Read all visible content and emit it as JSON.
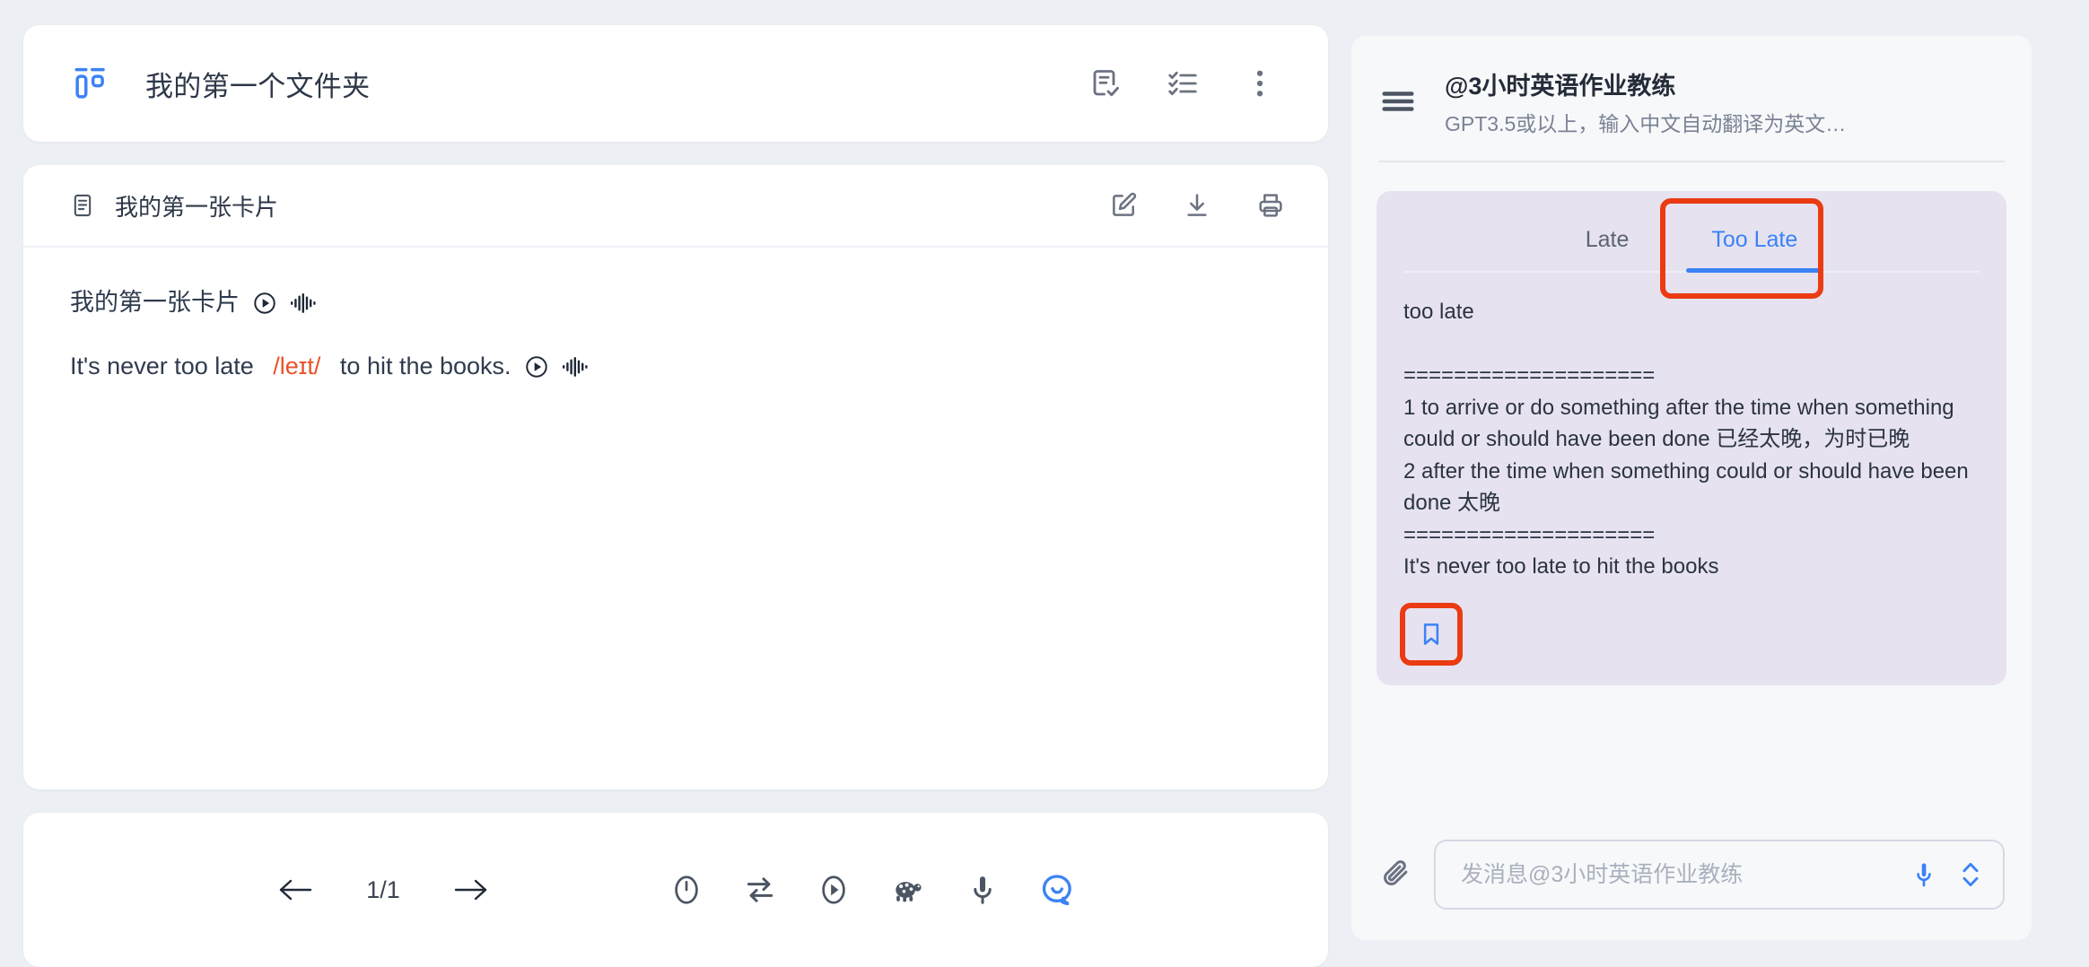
{
  "colors": {
    "page_bg": "#eceff4",
    "card_bg": "#ffffff",
    "accent_blue": "#3b82f6",
    "annotation_red": "#ea3b13",
    "bubble_bg": "#e6e2f0",
    "phonetic_red": "#e8532a",
    "panel_bg": "#f7f8fa"
  },
  "folder": {
    "icon": "folder-grid-icon",
    "title": "我的第一个文件夹",
    "actions": [
      {
        "icon": "document-check-icon",
        "name": "document-check"
      },
      {
        "icon": "checklist-icon",
        "name": "checklist"
      },
      {
        "icon": "more-vertical-icon",
        "name": "more-options"
      }
    ]
  },
  "note": {
    "icon": "note-document-icon",
    "title": "我的第一张卡片",
    "actions": [
      {
        "icon": "edit-pencil-icon",
        "name": "edit"
      },
      {
        "icon": "download-icon",
        "name": "download"
      },
      {
        "icon": "print-icon",
        "name": "print"
      }
    ],
    "lines": [
      {
        "segments": [
          {
            "text": "我的第一张卡片 ",
            "style": "normal"
          }
        ]
      },
      {
        "segments": [
          {
            "text": "It's never too late ",
            "style": "normal"
          },
          {
            "text": "/leɪt/",
            "style": "phonetic"
          },
          {
            "text": " to hit the books.",
            "style": "normal"
          }
        ]
      }
    ],
    "line1_prefix": "我的第一张卡片",
    "line2_pre": "It's never too late ",
    "line2_phonetic": "/leɪt/",
    "line2_post": " to hit the books."
  },
  "toolbar": {
    "prev_label": "prev-arrow-icon",
    "page_label": "1/1",
    "next_label": "next-arrow-icon",
    "tools": [
      {
        "icon": "timer-icon",
        "name": "timer"
      },
      {
        "icon": "repeat-icon",
        "name": "repeat"
      },
      {
        "icon": "play-circle-icon",
        "name": "play"
      },
      {
        "icon": "turtle-icon",
        "name": "slow-speed"
      },
      {
        "icon": "microphone-icon",
        "name": "record"
      },
      {
        "icon": "chat-bubble-icon",
        "name": "chat"
      }
    ]
  },
  "chat": {
    "menu_icon": "hamburger-menu-icon",
    "name": "@3小时英语作业教练",
    "subtitle": "GPT3.5或以上，输入中文自动翻译为英文…",
    "tabs": [
      {
        "label": "Late",
        "active": false
      },
      {
        "label": "Too Late",
        "active": true
      }
    ],
    "message": "too late\n\n====================\n1 to arrive or do something after the time when something could or should have been done 已经太晚，为时已晚\n2 after the time when something could or should have been done 太晚\n====================\nIt's never too late to hit the books",
    "bookmark_icon": "bookmark-icon",
    "input": {
      "attach_icon": "paperclip-icon",
      "placeholder": "发消息@3小时英语作业教练",
      "value": "",
      "mic_icon": "microphone-icon",
      "expand_icon": "expand-chevrons-icon"
    }
  }
}
